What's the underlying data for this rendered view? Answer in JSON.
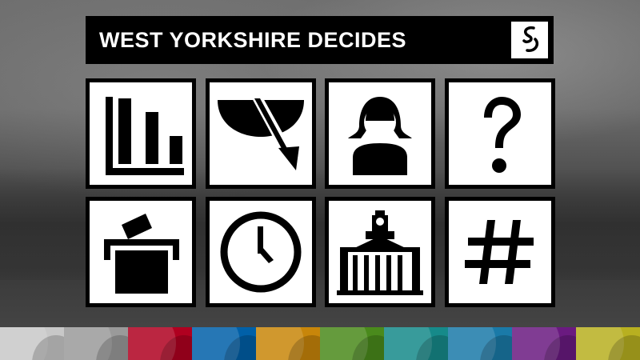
{
  "header": {
    "title": "WEST YORKSHIRE DECIDES",
    "logo_icon": "bbc-swirl-logo-icon"
  },
  "tiles": [
    {
      "name": "results-chart-icon"
    },
    {
      "name": "swingometer-icon"
    },
    {
      "name": "candidate-profile-icon"
    },
    {
      "name": "question-icon"
    },
    {
      "name": "ballot-box-icon"
    },
    {
      "name": "clock-icon"
    },
    {
      "name": "town-hall-icon"
    },
    {
      "name": "hashtag-icon"
    }
  ],
  "strip_colors": [
    "#c8c8c8",
    "#9a9a9a",
    "#b00020",
    "#0060a8",
    "#c8860a",
    "#4a8a1c",
    "#168a8a",
    "#1a7aa8",
    "#6a1a80",
    "#b8b020"
  ]
}
